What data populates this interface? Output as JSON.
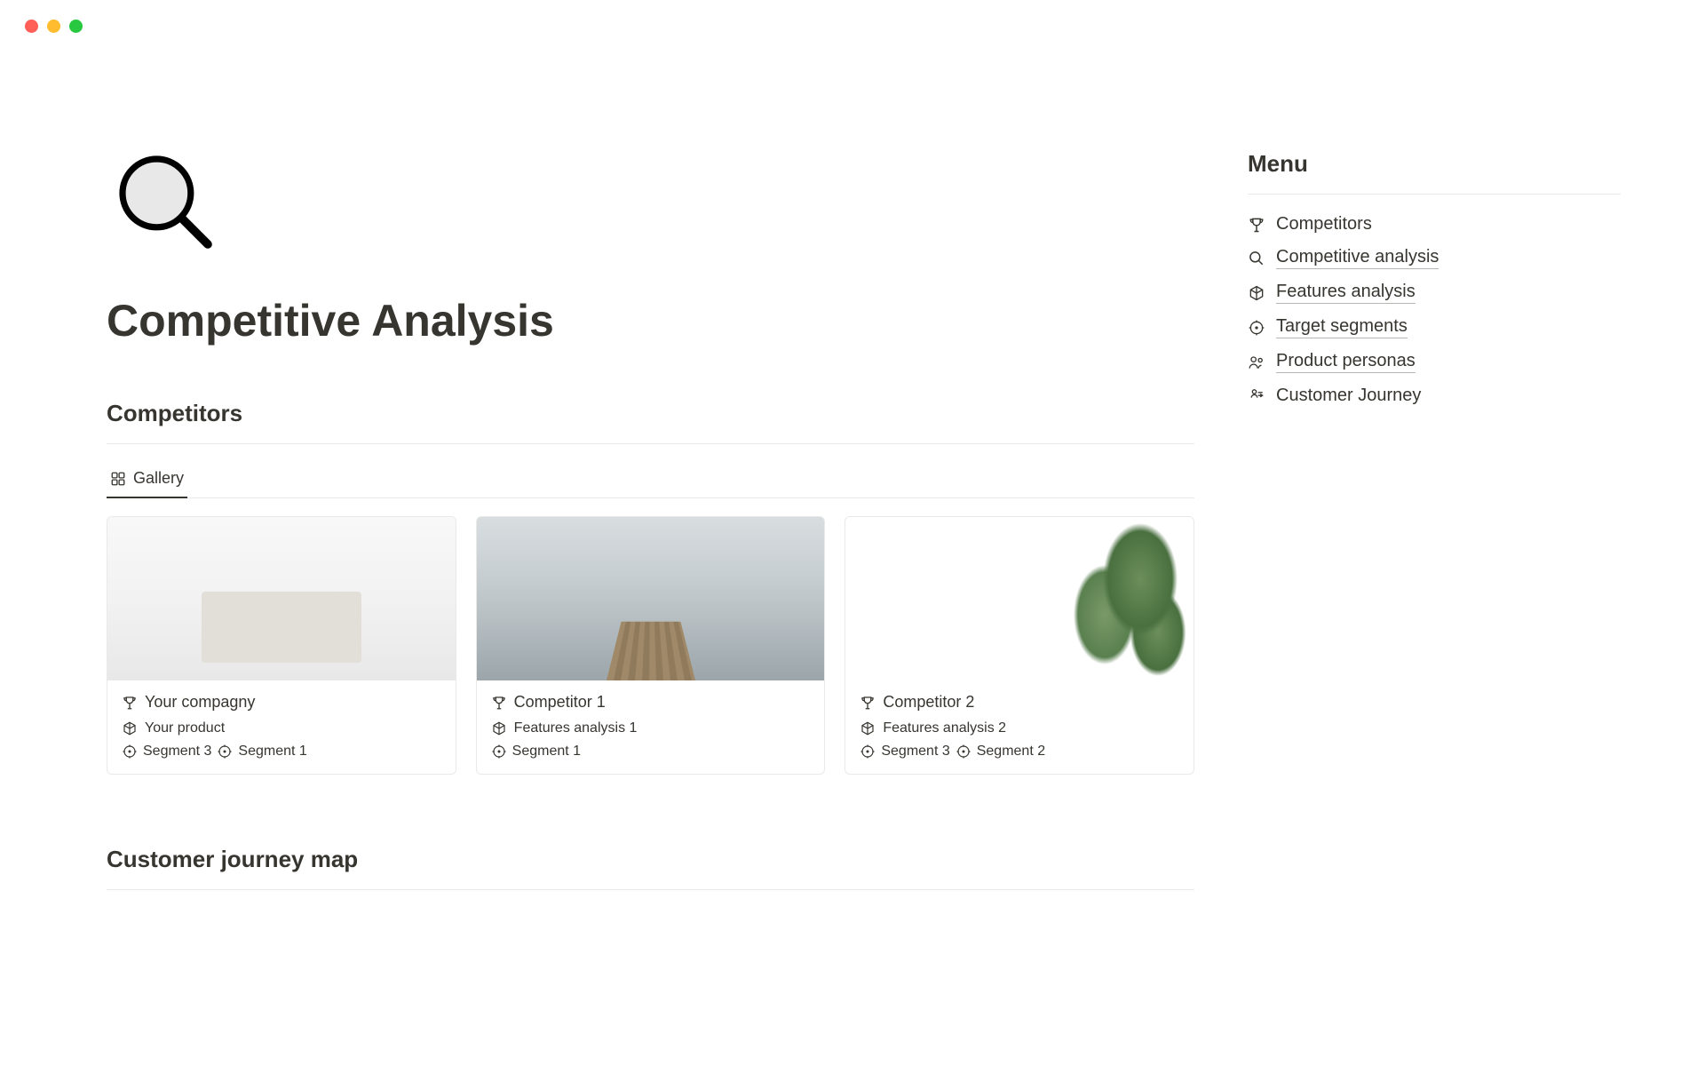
{
  "page": {
    "title": "Competitive Analysis"
  },
  "sections": {
    "competitors_title": "Competitors",
    "journey_title": "Customer journey map"
  },
  "view_tab": {
    "label": "Gallery"
  },
  "cards": [
    {
      "title": "Your compagny",
      "feature": "Your product",
      "segments": [
        "Segment 3",
        "Segment 1"
      ]
    },
    {
      "title": "Competitor 1",
      "feature": "Features analysis 1",
      "segments": [
        "Segment 1"
      ]
    },
    {
      "title": "Competitor 2",
      "feature": "Features analysis 2",
      "segments": [
        "Segment 3",
        "Segment 2"
      ]
    }
  ],
  "menu": {
    "title": "Menu",
    "items": [
      {
        "label": "Competitors",
        "icon": "trophy",
        "underlined": false
      },
      {
        "label": "Competitive analysis",
        "icon": "magnifier",
        "underlined": true
      },
      {
        "label": "Features analysis",
        "icon": "cube",
        "underlined": true
      },
      {
        "label": "Target segments",
        "icon": "target",
        "underlined": true
      },
      {
        "label": "Product personas",
        "icon": "people",
        "underlined": true
      },
      {
        "label": "Customer Journey",
        "icon": "journey",
        "underlined": false
      }
    ]
  }
}
